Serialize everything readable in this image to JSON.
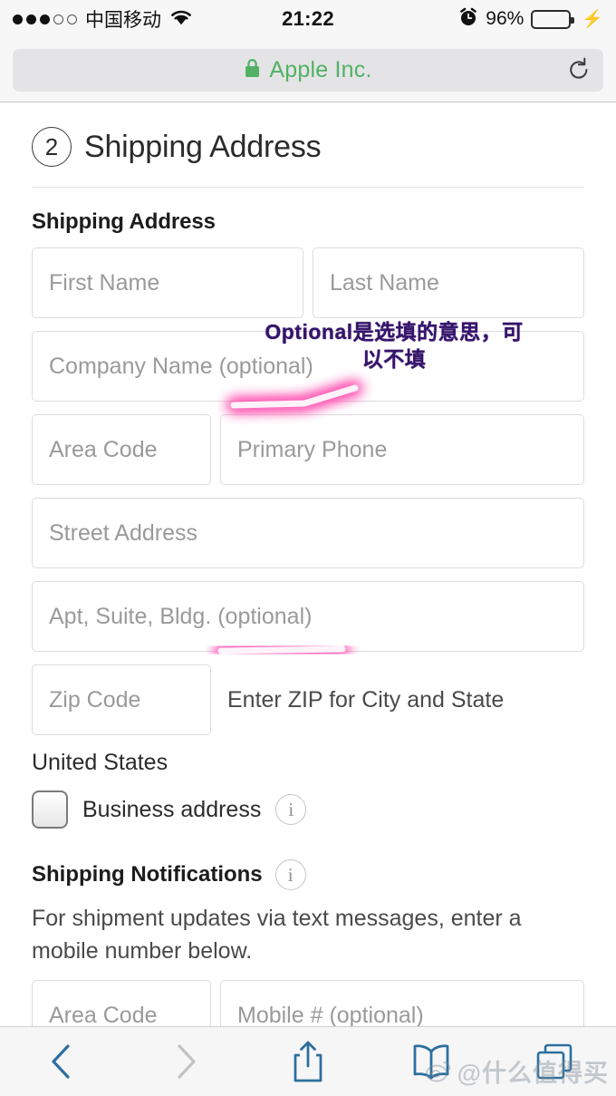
{
  "status_bar": {
    "signal_dots_filled": 3,
    "signal_dots_total": 5,
    "carrier": "中国移动",
    "wifi_icon": "wifi-icon",
    "time": "21:22",
    "alarm_icon": "alarm-clock-icon",
    "battery_percent": "96%",
    "battery_level": 96,
    "battery_color": "#4cd964",
    "charging_icon": "lightning-bolt-icon"
  },
  "browser": {
    "lock_icon": "lock-icon",
    "site_name": "Apple Inc.",
    "site_name_color": "#51b265",
    "reload_icon": "reload-icon"
  },
  "page": {
    "step_number": "2",
    "step_title": "Shipping Address",
    "section_label": "Shipping Address",
    "fields": {
      "first_name": "First Name",
      "last_name": "Last Name",
      "company_name": "Company Name (optional)",
      "area_code": "Area Code",
      "primary_phone": "Primary Phone",
      "street_address": "Street Address",
      "apt_suite": "Apt, Suite, Bldg. (optional)",
      "zip_code": "Zip Code",
      "zip_hint": "Enter ZIP for City and State",
      "notif_area_code": "Area Code",
      "mobile_number": "Mobile # (optional)"
    },
    "country": "United States",
    "business_address_label": "Business address",
    "business_address_checked": false,
    "info_icon": "info-icon",
    "notifications": {
      "title": "Shipping Notifications",
      "info_icon": "info-icon",
      "body": "For shipment updates via text messages, enter a mobile number below."
    }
  },
  "annotations": {
    "company_note": "Optional是选填的意思，可\n以不填",
    "ink_color": "#35146b",
    "highlighter_color": "#ff6fc0"
  },
  "toolbar": {
    "back_icon": "chevron-left-icon",
    "back_enabled": true,
    "forward_icon": "chevron-right-icon",
    "forward_enabled": false,
    "share_icon": "share-icon",
    "bookmarks_icon": "book-icon",
    "tabs_icon": "tabs-icon",
    "icon_color": "#2d6f9e"
  },
  "watermark": {
    "logo_icon": "weibo-icon",
    "text": "@什么值得买"
  }
}
